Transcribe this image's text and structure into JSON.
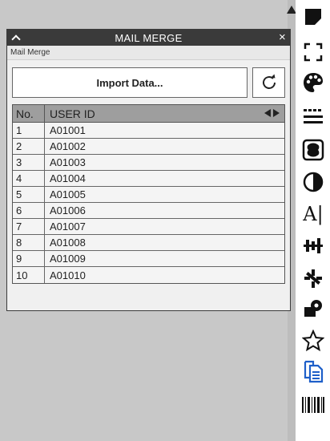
{
  "panel": {
    "title": "MAIL MERGE",
    "close_glyph": "×",
    "subtitle": "Mail Merge",
    "import_label": "Import Data...",
    "refresh_icon": "refresh-icon"
  },
  "table": {
    "headers": {
      "no": "No.",
      "user_id": "USER ID"
    },
    "rows": [
      {
        "no": "1",
        "user_id": "A01001"
      },
      {
        "no": "2",
        "user_id": "A01002"
      },
      {
        "no": "3",
        "user_id": "A01003"
      },
      {
        "no": "4",
        "user_id": "A01004"
      },
      {
        "no": "5",
        "user_id": "A01005"
      },
      {
        "no": "6",
        "user_id": "A01006"
      },
      {
        "no": "7",
        "user_id": "A01007"
      },
      {
        "no": "8",
        "user_id": "A01008"
      },
      {
        "no": "9",
        "user_id": "A01009"
      },
      {
        "no": "10",
        "user_id": "A01010"
      }
    ]
  },
  "toolbar": {
    "tools": [
      "shape-icon",
      "crop-icon",
      "palette-icon",
      "lines-icon",
      "stamp-icon",
      "contrast-icon",
      "text-cursor-icon",
      "distribute-icon",
      "sparkle-icon",
      "fill-icon",
      "star-icon",
      "mail-merge-icon",
      "barcode-icon"
    ],
    "active_tool": "mail-merge-icon",
    "text_tool_glyph": "A|"
  },
  "colors": {
    "titlebar": "#3a3a3a",
    "table_header": "#9e9e9e",
    "active_icon": "#1e5fc9",
    "workspace": "#c8c8c8"
  }
}
